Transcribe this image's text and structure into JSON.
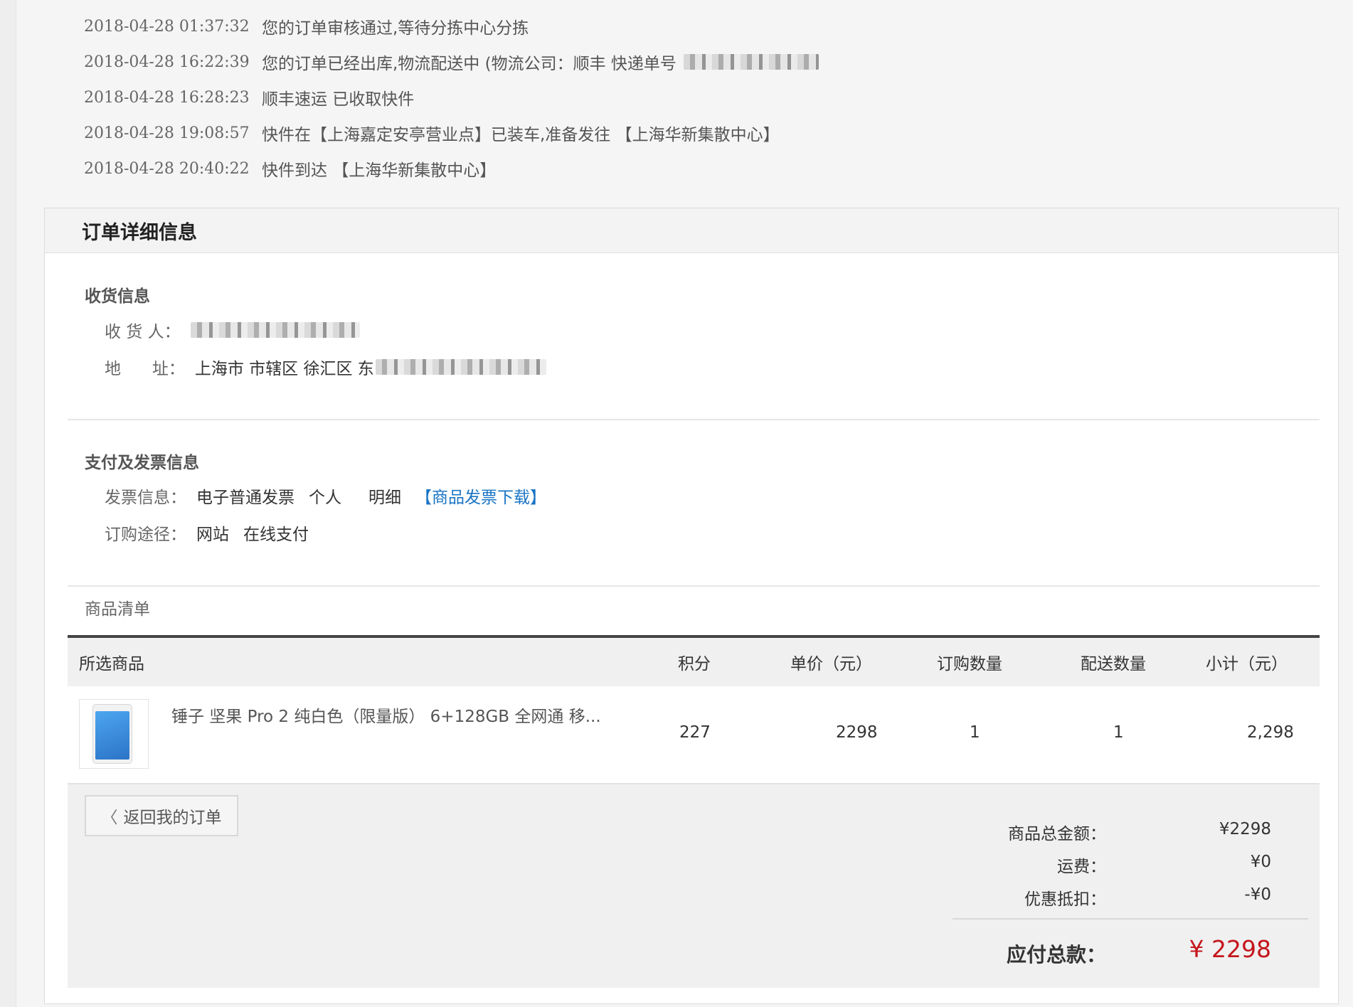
{
  "tracking": [
    {
      "time": "2018-04-28 01:37:32",
      "text": "您的订单审核通过,等待分拣中心分拣"
    },
    {
      "time": "2018-04-28 16:22:39",
      "text": "您的订单已经出库,物流配送中 (物流公司：顺丰  快递单号"
    },
    {
      "time": "2018-04-28 16:28:23",
      "text": "顺丰速运 已收取快件"
    },
    {
      "time": "2018-04-28 19:08:57",
      "text": "快件在【上海嘉定安亭营业点】已装车,准备发往 【上海华新集散中心】"
    },
    {
      "time": "2018-04-28 20:40:22",
      "text": "快件到达 【上海华新集散中心】"
    }
  ],
  "panel": {
    "title": "订单详细信息"
  },
  "shipping": {
    "title": "收货信息",
    "receiver_label": "收 货 人：",
    "address_label": "地      址：",
    "address_value": "上海市 市辖区 徐汇区 东"
  },
  "payment": {
    "title": "支付及发票信息",
    "invoice_label": "发票信息：",
    "invoice_type": "电子普通发票",
    "invoice_title": "个人",
    "invoice_content": "明细",
    "invoice_download": "【商品发票下载】",
    "channel_label": "订购途径：",
    "channel": "网站",
    "pay_method": "在线支付"
  },
  "goods": {
    "title": "商品清单",
    "columns": [
      "所选商品",
      "积分",
      "单价（元）",
      "订购数量",
      "配送数量",
      "小计（元）"
    ],
    "items": [
      {
        "name": "锤子 坚果 Pro 2 纯白色（限量版） 6+128GB 全网通 移...",
        "points": "227",
        "price": "2298",
        "order_qty": "1",
        "ship_qty": "1",
        "subtotal": "2,298"
      }
    ]
  },
  "summary": {
    "back_label": "返回我的订单",
    "goods_total_label": "商品总金额：",
    "goods_total": "¥2298",
    "shipping_label": "运费：",
    "shipping": "¥0",
    "discount_label": "优惠抵扣：",
    "discount": "-¥0",
    "payable_label": "应付总款：",
    "payable": "¥ 2298"
  },
  "colors": {
    "link": "#1a74c4",
    "total": "#c4161c",
    "table_rule": "#444444"
  }
}
